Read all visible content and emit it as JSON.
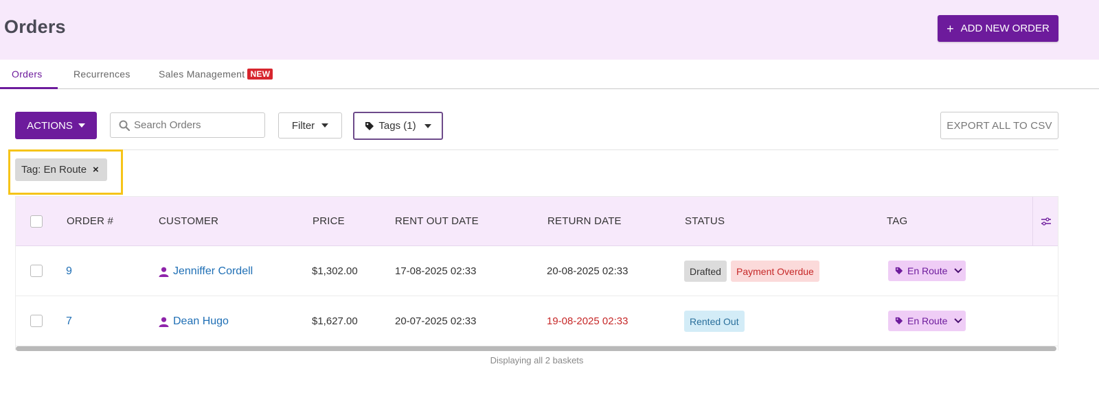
{
  "header": {
    "title": "Orders",
    "add_button_icon": "+",
    "add_button_label": "ADD NEW ORDER"
  },
  "tabs": [
    {
      "label": "Orders",
      "active": true
    },
    {
      "label": "Recurrences",
      "active": false
    },
    {
      "label": "Sales Management",
      "active": false,
      "badge": "NEW"
    }
  ],
  "toolbar": {
    "actions_label": "ACTIONS",
    "search_placeholder": "Search Orders",
    "search_value": "",
    "filter_label": "Filter",
    "tags_label": "Tags (1)",
    "export_label": "EXPORT ALL TO CSV"
  },
  "active_filter": {
    "chip_label": "Tag: En Route",
    "close_glyph": "×"
  },
  "table": {
    "columns": [
      "ORDER #",
      "CUSTOMER",
      "PRICE",
      "RENT OUT DATE",
      "RETURN DATE",
      "STATUS",
      "TAG"
    ],
    "rows": [
      {
        "order": "9",
        "customer": "Jenniffer Cordell",
        "price": "$1,302.00",
        "rent_out": "17-08-2025 02:33",
        "return": "20-08-2025 02:33",
        "statuses": [
          "Drafted",
          "Payment Overdue"
        ],
        "tag": "En Route"
      },
      {
        "order": "7",
        "customer": "Dean Hugo",
        "price": "$1,627.00",
        "rent_out": "20-07-2025 02:33",
        "return": "19-08-2025 02:33",
        "statuses": [
          "Rented Out"
        ],
        "tag": "En Route"
      }
    ]
  },
  "footer": {
    "summary": "Displaying all 2 baskets"
  },
  "colors": {
    "brand": "#6d1b9c",
    "header_bg": "#f7e9fb",
    "overdue": "#c62828",
    "highlight": "#f6c419"
  }
}
